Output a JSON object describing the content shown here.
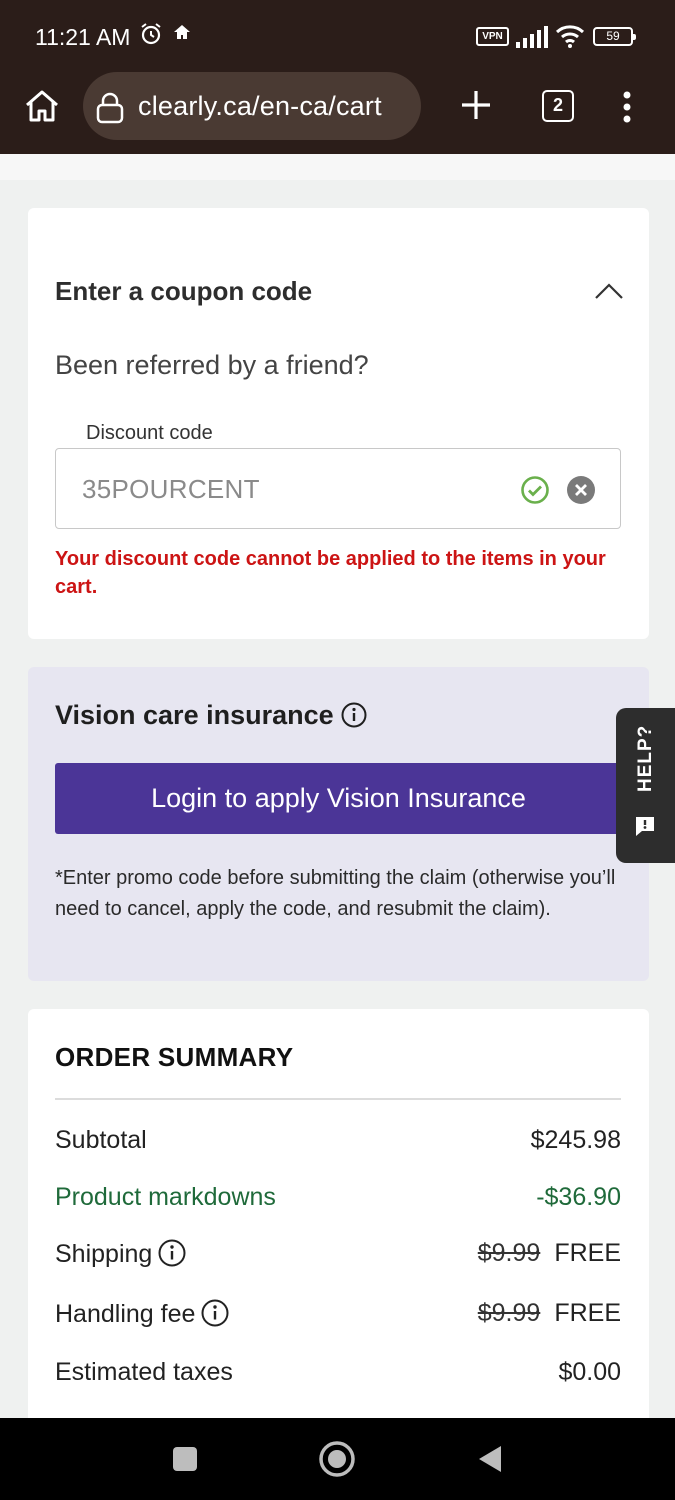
{
  "status_bar": {
    "time": "11:21 AM",
    "vpn": "VPN",
    "battery": "59"
  },
  "browser": {
    "url": "clearly.ca/en-ca/cart",
    "tab_count": "2"
  },
  "coupon": {
    "title": "Enter a coupon code",
    "referral": "Been referred by a friend?",
    "field_label": "Discount code",
    "field_value": "35POURCENT",
    "error": "Your discount code cannot be applied to the items in your cart."
  },
  "insurance": {
    "title": "Vision care insurance",
    "button": "Login to apply Vision Insurance",
    "note": "*Enter promo code before submitting the claim (otherwise you’ll need to cancel, apply the code, and resubmit the claim)."
  },
  "help_tab": {
    "label": "HELP?"
  },
  "order_summary": {
    "title": "ORDER SUMMARY",
    "rows": [
      {
        "label": "Subtotal",
        "value": "$245.98"
      },
      {
        "label": "Product markdowns",
        "value": "-$36.90"
      },
      {
        "label": "Shipping",
        "old": "$9.99",
        "value": "FREE"
      },
      {
        "label": "Handling fee",
        "old": "$9.99",
        "value": "FREE"
      },
      {
        "label": "Estimated taxes",
        "value": "$0.00"
      }
    ]
  },
  "colors": {
    "chrome_bg": "#2b1d19",
    "accent_purple": "#4b3597",
    "error_red": "#cc1414",
    "markdown_green": "#1f6a3a",
    "success_green": "#6ab04c"
  }
}
